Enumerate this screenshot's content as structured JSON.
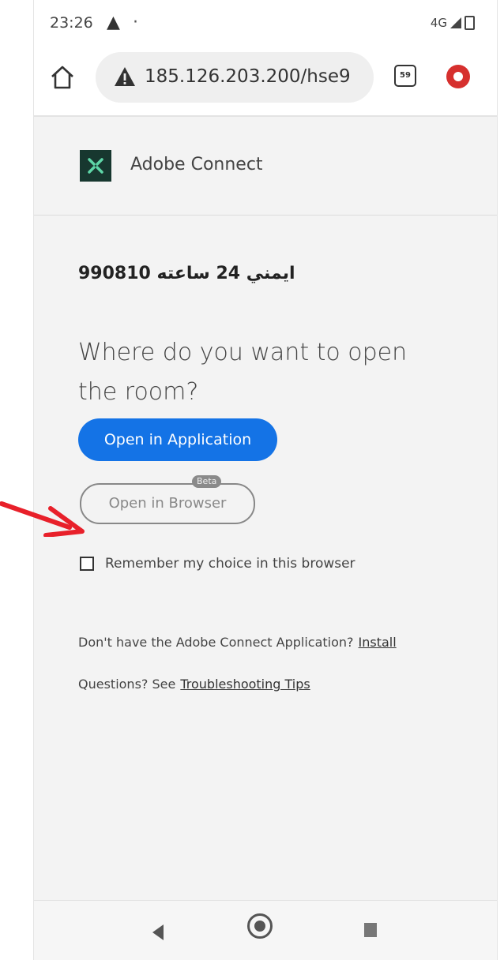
{
  "status_bar": {
    "time": "23:26",
    "network": "4G"
  },
  "browser": {
    "url": "185.126.203.200/hse9",
    "tab_count": "59"
  },
  "header": {
    "brand": "Adobe Connect"
  },
  "room": {
    "title": "ايمني 24 ساعته 990810"
  },
  "prompt": {
    "question": "Where do you want to open the room?"
  },
  "buttons": {
    "open_app": "Open in Application",
    "open_browser": "Open in Browser",
    "beta_badge": "Beta"
  },
  "remember": {
    "label": "Remember my choice in this browser",
    "checked": false
  },
  "install": {
    "text": "Don't have the Adobe Connect Application?",
    "link": "Install"
  },
  "help": {
    "text": "Questions? See",
    "link": "Troubleshooting Tips"
  },
  "colors": {
    "primary": "#1473e6",
    "arrow": "#e8202a",
    "logo_bg": "#17372f"
  }
}
